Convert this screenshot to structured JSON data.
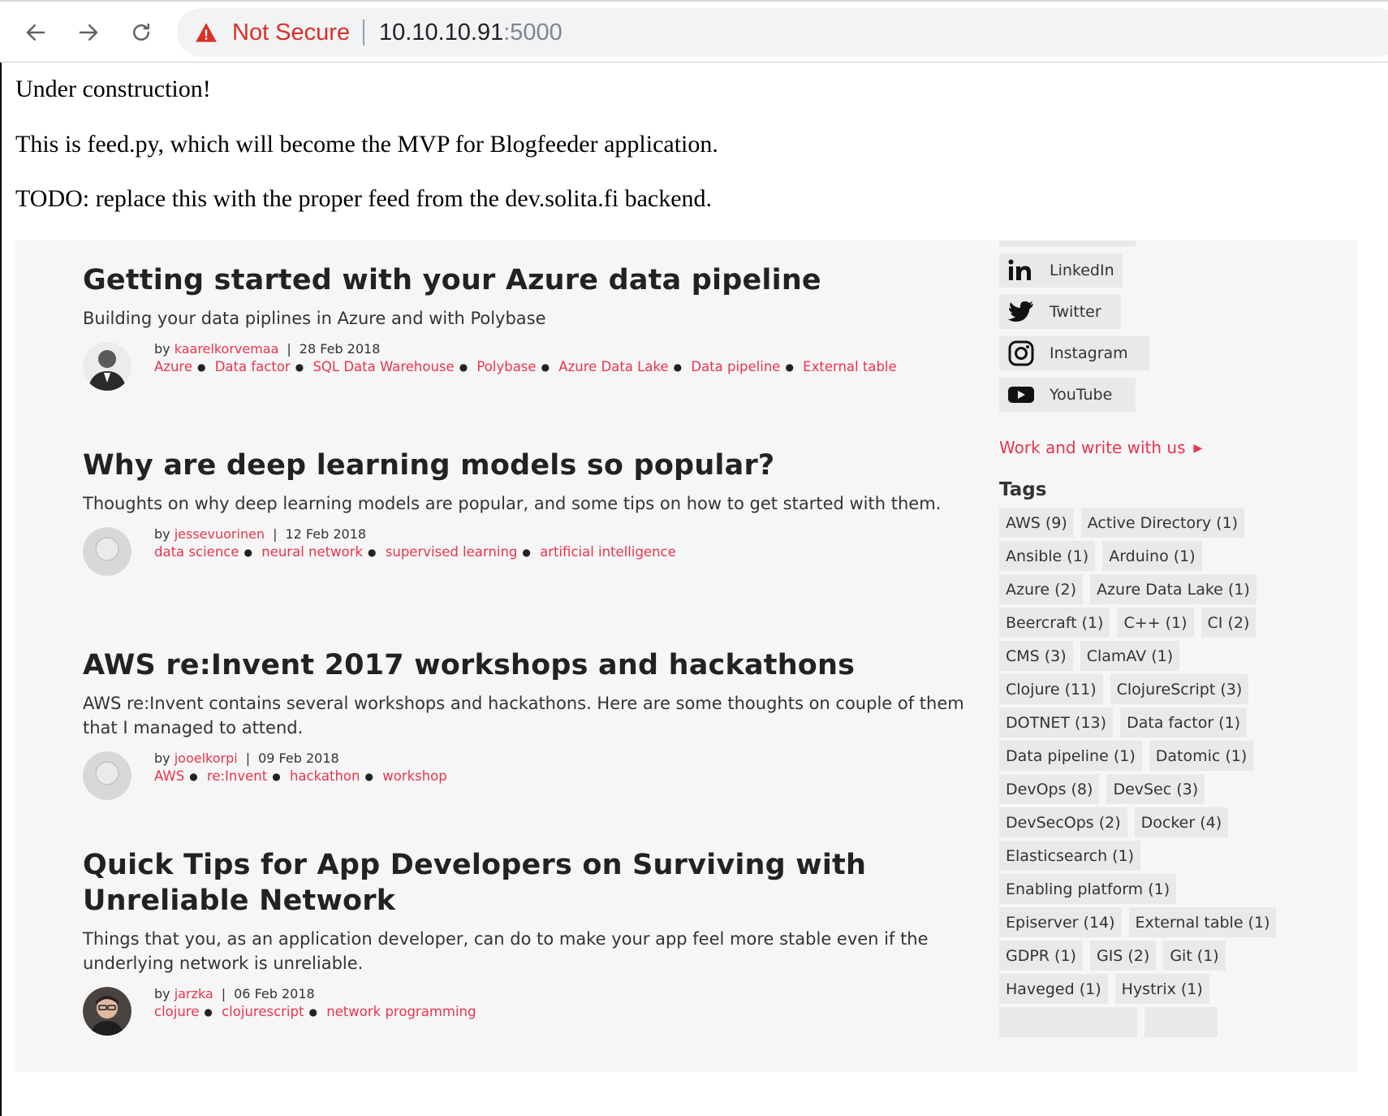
{
  "browser": {
    "security_label": "Not Secure",
    "url_host": "10.10.10.91",
    "url_port": ":5000"
  },
  "page": {
    "lines": [
      "Under construction!",
      "This is feed.py, which will become the MVP for Blogfeeder application.",
      "TODO: replace this with the proper feed from the dev.solita.fi backend."
    ]
  },
  "posts": [
    {
      "title": "Getting started with your Azure data pipeline",
      "description": "Building your data piplines in Azure and with Polybase",
      "by": "by",
      "author": "kaarelkorvemaa",
      "date": "28 Feb 2018",
      "tags": [
        "Azure",
        "Data factor",
        "SQL Data Warehouse",
        "Polybase",
        "Azure Data Lake",
        "Data pipeline",
        "External table"
      ]
    },
    {
      "title": "Why are deep learning models so popular?",
      "description": "Thoughts on why deep learning models are popular, and some tips on how to get started with them.",
      "by": "by",
      "author": "jessevuorinen",
      "date": "12 Feb 2018",
      "tags": [
        "data science",
        "neural network",
        "supervised learning",
        "artificial intelligence"
      ]
    },
    {
      "title": "AWS re:Invent 2017 workshops and hackathons",
      "description": "AWS re:Invent contains several workshops and hackathons. Here are some thoughts on couple of them that I managed to attend.",
      "by": "by",
      "author": "jooelkorpi",
      "date": "09 Feb 2018",
      "tags": [
        "AWS",
        "re:Invent",
        "hackathon",
        "workshop"
      ]
    },
    {
      "title": "Quick Tips for App Developers on Surviving with Unreliable Network",
      "description": "Things that you, as an application developer, can do to make your app feel more stable even if the underlying network is unreliable.",
      "by": "by",
      "author": "jarzka",
      "date": "06 Feb 2018",
      "tags": [
        "clojure",
        "clojurescript",
        "network programming"
      ]
    }
  ],
  "sidebar": {
    "social": [
      {
        "label": "LinkedIn",
        "icon": "linkedin-icon"
      },
      {
        "label": "Twitter",
        "icon": "twitter-icon"
      },
      {
        "label": "Instagram",
        "icon": "instagram-icon"
      },
      {
        "label": "YouTube",
        "icon": "youtube-icon"
      }
    ],
    "work_link": "Work and write with us",
    "tags_heading": "Tags",
    "tag_rows": [
      [
        "AWS (9)",
        "Active Directory (1)"
      ],
      [
        "Ansible (1)",
        "Arduino (1)"
      ],
      [
        "Azure (2)",
        "Azure Data Lake (1)"
      ],
      [
        "Beercraft (1)",
        "C++ (1)",
        "CI (2)"
      ],
      [
        "CMS (3)",
        "ClamAV (1)"
      ],
      [
        "Clojure (11)",
        "ClojureScript (3)"
      ],
      [
        "DOTNET (13)",
        "Data factor (1)"
      ],
      [
        "Data pipeline (1)",
        "Datomic (1)"
      ],
      [
        "DevOps (8)",
        "DevSec (3)"
      ],
      [
        "DevSecOps (2)",
        "Docker (4)"
      ],
      [
        "Elasticsearch (1)"
      ],
      [
        "Enabling platform (1)"
      ],
      [
        "Episerver (14)",
        "External table (1)"
      ],
      [
        "GDPR (1)",
        "GIS (2)",
        "Git (1)"
      ],
      [
        "Haveged (1)",
        "Hystrix (1)"
      ]
    ]
  },
  "colors": {
    "accent": "#e8344e",
    "warning": "#d93025"
  }
}
